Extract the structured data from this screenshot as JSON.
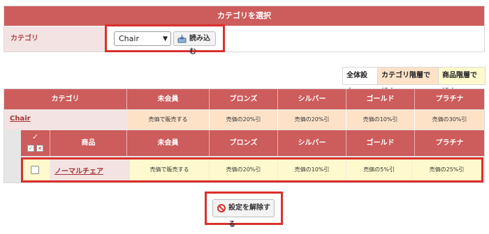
{
  "category_panel": {
    "header": "カテゴリを選択",
    "label": "カテゴリ",
    "select_value": "Chair",
    "load_button": "読み込む"
  },
  "setting_tabs": [
    "全体設定",
    "カテゴリ階層で設定",
    "商品階層で設定"
  ],
  "table": {
    "category_header": "カテゴリ",
    "member_columns": [
      "未会員",
      "ブロンズ",
      "シルバー",
      "ゴールド",
      "プラチナ"
    ],
    "category_row": {
      "name": "Chair",
      "values": [
        "売価で販売する",
        "売価の20%引",
        "売価の20%引",
        "売価の10%引",
        "売価の30%引"
      ]
    },
    "product_header": "商品",
    "product_columns": [
      "未会員",
      "ブロンズ",
      "シルバー",
      "ゴールド",
      "プラチナ"
    ],
    "check_mark": "✓",
    "product_row": {
      "name": "ノーマルチェア",
      "values": [
        "売価で販売する",
        "売価の20%引",
        "売価の10%引",
        "売価の5%引",
        "売価の25%引"
      ]
    }
  },
  "release_button": "設定を解除する",
  "colors": {
    "header_red": "#cd5c5c",
    "highlight_frame": "#d9302c",
    "category_row_bg": "#fde2c8",
    "product_row_bg": "#fffacd"
  }
}
